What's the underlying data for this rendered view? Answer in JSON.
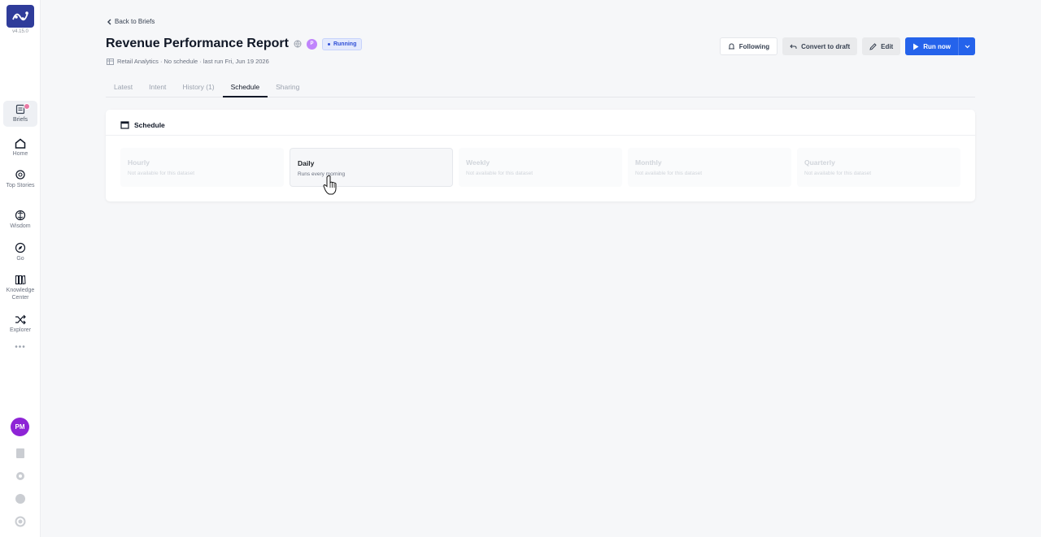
{
  "app": {
    "version": "v4.15.0"
  },
  "sidebar": {
    "items": [
      {
        "label": "Briefs",
        "icon": "briefs-icon"
      },
      {
        "label": "Home",
        "icon": "home-icon"
      },
      {
        "label": "Top Stories",
        "icon": "top-stories-icon"
      },
      {
        "label": "Wisdom",
        "icon": "wisdom-icon"
      },
      {
        "label": "Go",
        "icon": "compass-icon"
      },
      {
        "label": "Knowledge Center",
        "icon": "knowledge-icon"
      },
      {
        "label": "Explorer",
        "icon": "shuffle-icon"
      }
    ],
    "more": "•••",
    "user_initials": "PM"
  },
  "header": {
    "back_label": "Back to Briefs",
    "title": "Revenue Performance Report",
    "owner_initial": "P",
    "status": "Running",
    "meta": "Retail Analytics · No schedule · last run Fri, Jun 19 2026"
  },
  "actions": {
    "following": "Following",
    "convert": "Convert to draft",
    "edit": "Edit",
    "run": "Run now"
  },
  "tabs": [
    {
      "label": "Latest"
    },
    {
      "label": "Intent"
    },
    {
      "label": "History (1)"
    },
    {
      "label": "Schedule"
    },
    {
      "label": "Sharing"
    }
  ],
  "schedule": {
    "heading": "Schedule",
    "options": [
      {
        "name": "Hourly",
        "desc": "Not available for this dataset"
      },
      {
        "name": "Daily",
        "desc": "Runs every morning"
      },
      {
        "name": "Weekly",
        "desc": "Not available for this dataset"
      },
      {
        "name": "Monthly",
        "desc": "Not available for this dataset"
      },
      {
        "name": "Quarterly",
        "desc": "Not available for this dataset"
      }
    ]
  },
  "colors": {
    "accent": "#2563eb",
    "logo": "#2f3c9a",
    "avatar": "#8e24d6",
    "status_bg": "#e3e9fd"
  }
}
